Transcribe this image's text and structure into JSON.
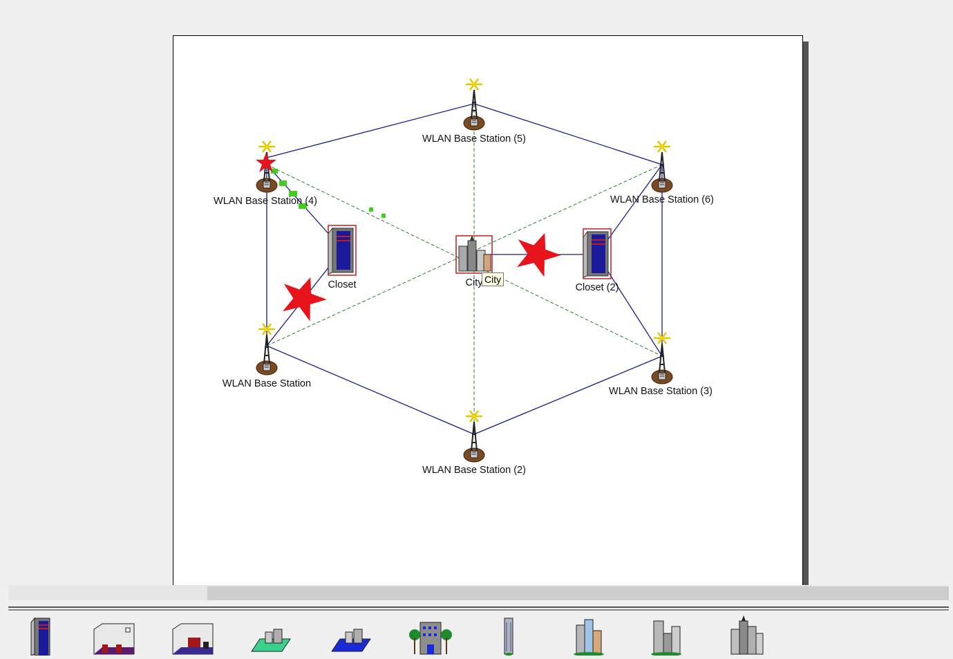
{
  "diagram": {
    "nodes": {
      "bs5": "WLAN Base Station (5)",
      "bs4": "WLAN Base Station (4)",
      "bs6": "WLAN Base Station (6)",
      "bs1": "WLAN Base Station",
      "bs3": "WLAN Base Station (3)",
      "bs2": "WLAN Base Station (2)",
      "closet": "Closet",
      "closet2": "Closet (2)",
      "city": "City"
    },
    "tooltip": "City",
    "colors": {
      "ring_link": "#1a1a8c",
      "cross_link": "#2e7d32",
      "failure_star": "#e8141c",
      "packet": "#44cc22"
    }
  },
  "palette": {
    "items": [
      "closet-icon",
      "office-icon",
      "office-2-icon",
      "campus-green-icon",
      "campus-blue-icon",
      "building-trees-icon",
      "tower-icon",
      "city-block-icon",
      "city-icon",
      "city-large-icon"
    ]
  }
}
